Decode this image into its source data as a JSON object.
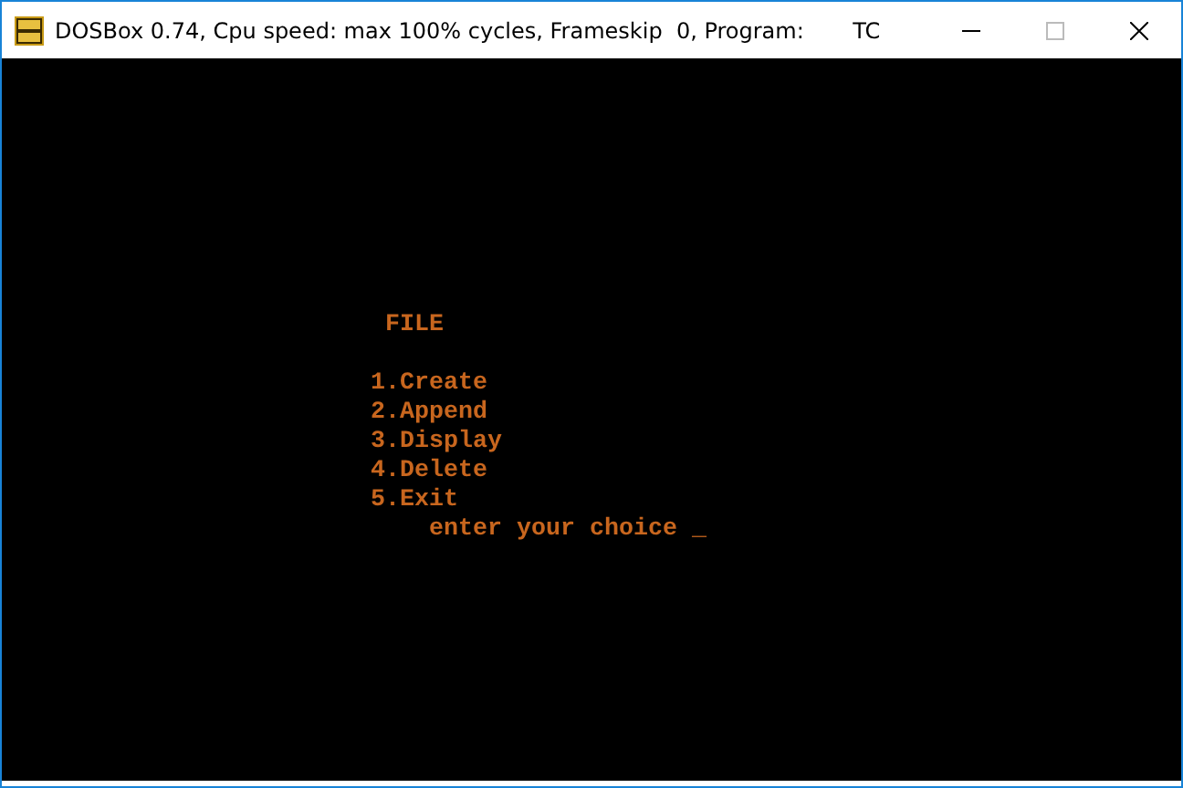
{
  "window": {
    "title": "DOSBox 0.74, Cpu speed: max 100% cycles, Frameskip  0, Program:       TC"
  },
  "screen": {
    "lines": [
      {
        "kind": "heading",
        "text": "FILE"
      },
      {
        "kind": "blank"
      },
      {
        "kind": "option",
        "text": "1.Create"
      },
      {
        "kind": "option",
        "text": "2.Append"
      },
      {
        "kind": "option",
        "text": "3.Display"
      },
      {
        "kind": "option",
        "text": "4.Delete"
      },
      {
        "kind": "option",
        "text": "5.Exit"
      },
      {
        "kind": "prompt",
        "text": "enter your choice",
        "cursor": "_"
      }
    ]
  }
}
